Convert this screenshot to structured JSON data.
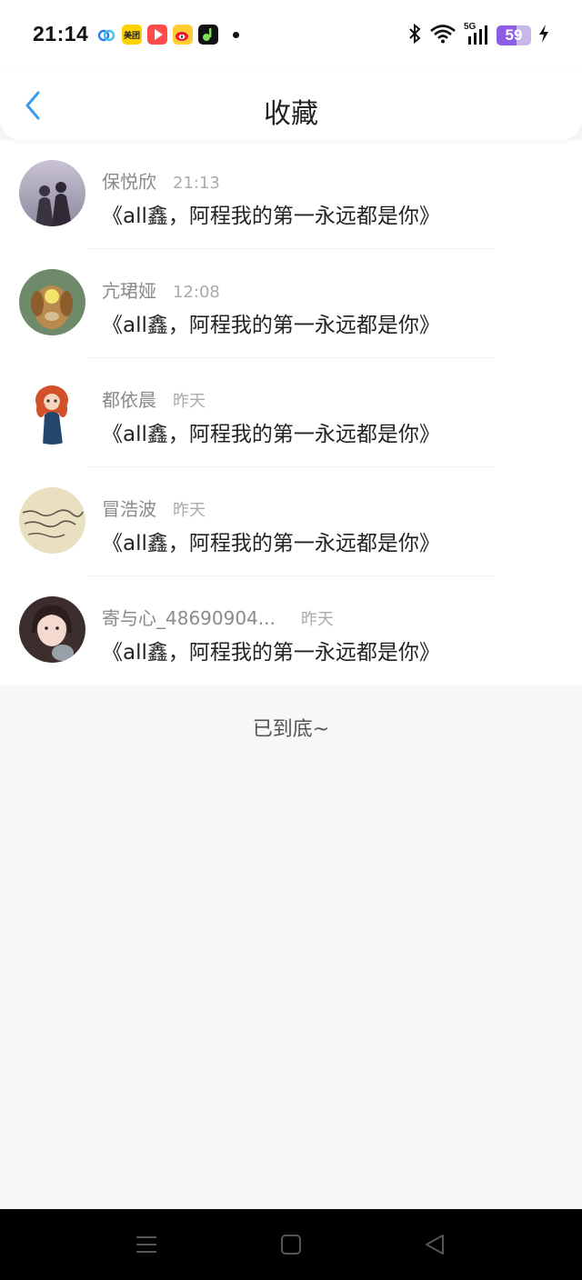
{
  "status_bar": {
    "time": "21:14",
    "battery": 59,
    "network": "5G",
    "apps": [
      {
        "icon": "baidu-netdisk-icon",
        "label": ""
      },
      {
        "icon": "meituan-icon",
        "label": "美团"
      },
      {
        "icon": "video-app-icon",
        "label": ""
      },
      {
        "icon": "weibo-icon",
        "label": ""
      },
      {
        "icon": "music-app-icon",
        "label": ""
      }
    ],
    "system_icons": [
      "bluetooth-icon",
      "wifi-icon",
      "signal-icon",
      "battery-icon",
      "charging-icon"
    ]
  },
  "header": {
    "title": "收藏",
    "back_icon": "chevron-left-icon"
  },
  "items": [
    {
      "name": "保悦欣",
      "time": "21:13",
      "text": "《all鑫，阿程我的第一永远都是你》",
      "avatar": "couple-silhouette"
    },
    {
      "name": "亢珺娅",
      "time": "12:08",
      "text": "《all鑫，阿程我的第一永远都是你》",
      "avatar": "dog-photo"
    },
    {
      "name": "都依晨",
      "time": "昨天",
      "text": "《all鑫，阿程我的第一永远都是你》",
      "avatar": "cartoon-red-hair-girl"
    },
    {
      "name": "冒浩波",
      "time": "昨天",
      "text": "《all鑫，阿程我的第一永远都是你》",
      "avatar": "handwriting-paper"
    },
    {
      "name": "寄与心_48690904...",
      "time": "昨天",
      "text": "《all鑫，阿程我的第一永远都是你》",
      "avatar": "girl-selfie"
    }
  ],
  "footer": {
    "end_text": "已到底~"
  },
  "nav_bar": {
    "buttons": [
      "menu-icon",
      "home-icon",
      "back-triangle-icon"
    ]
  },
  "colors": {
    "accent": "#3a9bf0",
    "background": "#f8f6f7",
    "battery": "#8c5ce6"
  }
}
